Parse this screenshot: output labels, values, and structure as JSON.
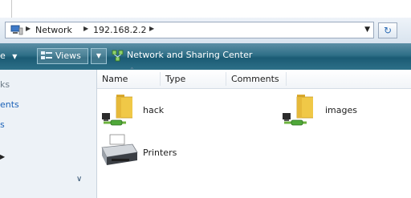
{
  "address_bar": {
    "crumbs": [
      "Network",
      "192.168.2.2"
    ],
    "refresh_icon": "refresh-icon"
  },
  "command_bar": {
    "organize_fragment": "e",
    "views_label": "Views",
    "network_center_label": "Network and Sharing Center"
  },
  "nav_pane": {
    "items": [
      "ks",
      "ents",
      "s"
    ]
  },
  "columns": {
    "name": "Name",
    "type": "Type",
    "comments": "Comments"
  },
  "items": [
    {
      "label": "hack",
      "icon": "network-folder-icon"
    },
    {
      "label": "images",
      "icon": "network-folder-icon"
    },
    {
      "label": "Printers",
      "icon": "printer-icon"
    }
  ],
  "colors": {
    "command_bar": "#2f6f87",
    "nav_link": "#1b62b8",
    "folder": "#f0c847"
  }
}
